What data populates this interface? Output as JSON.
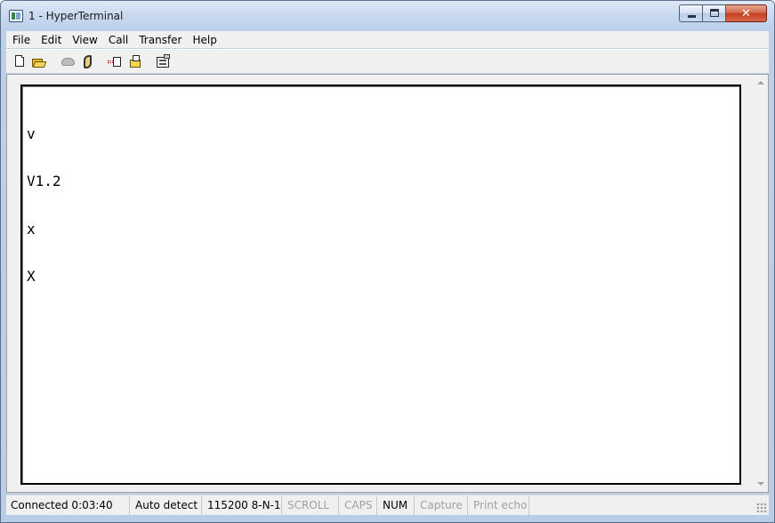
{
  "window": {
    "title": "1 - HyperTerminal",
    "close_glyph": "✕"
  },
  "menu": [
    "File",
    "Edit",
    "View",
    "Call",
    "Transfer",
    "Help"
  ],
  "toolbar": {
    "icons": [
      "new-file-icon",
      "open-folder-icon",
      "disconnect-icon",
      "dial-phone-icon",
      "send-file-icon",
      "receive-file-icon",
      "properties-icon"
    ]
  },
  "terminal": {
    "lines": [
      "v",
      "V1.2",
      "x",
      "X"
    ]
  },
  "status": {
    "connected": "Connected 0:03:40",
    "detect": "Auto detect",
    "baud": "115200 8-N-1",
    "scroll": "SCROLL",
    "caps": "CAPS",
    "num": "NUM",
    "capture": "Capture",
    "echo": "Print echo"
  },
  "colors": {
    "titlebar": "#c7d8ee",
    "close_button": "#c2401f",
    "chrome": "#f0f0f0",
    "terminal_bg": "#ffffff",
    "indicator_off": "#a0a0a0"
  }
}
